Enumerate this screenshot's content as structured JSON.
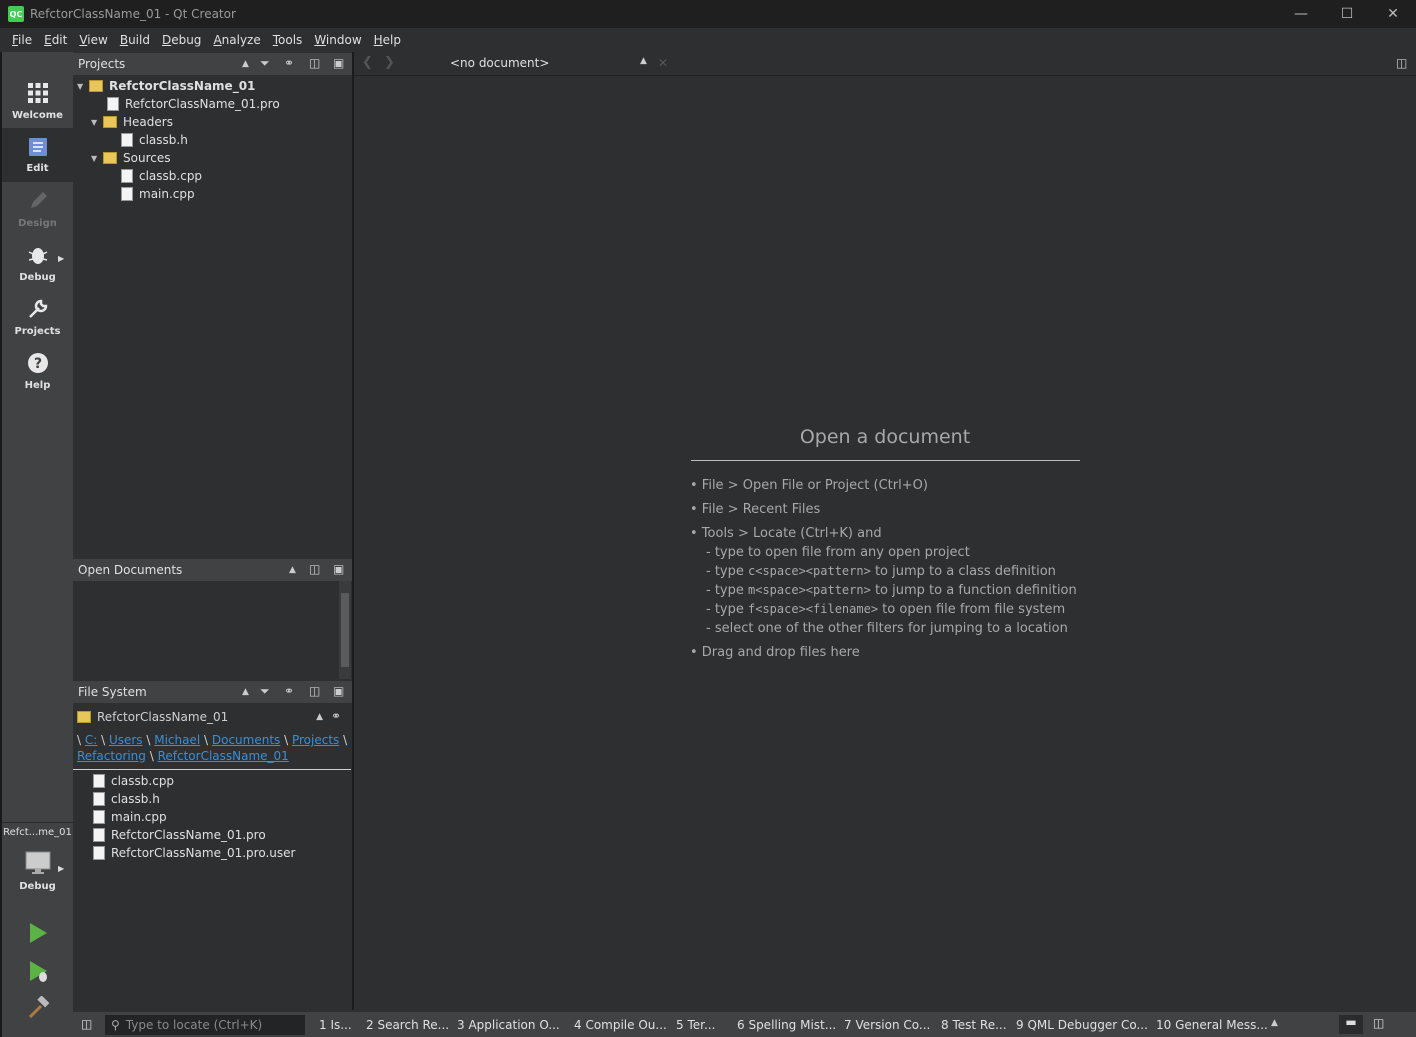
{
  "window": {
    "title": "RefctorClassName_01 - Qt Creator",
    "app_icon": "QC"
  },
  "menu": [
    {
      "mn": "F",
      "rest": "ile"
    },
    {
      "mn": "E",
      "rest": "dit"
    },
    {
      "mn": "V",
      "rest": "iew"
    },
    {
      "mn": "B",
      "rest": "uild"
    },
    {
      "mn": "D",
      "rest": "ebug"
    },
    {
      "mn": "A",
      "rest": "nalyze"
    },
    {
      "mn": "T",
      "rest": "ools"
    },
    {
      "mn": "W",
      "rest": "indow"
    },
    {
      "mn": "H",
      "rest": "elp"
    }
  ],
  "modes": {
    "welcome": "Welcome",
    "edit": "Edit",
    "design": "Design",
    "debug": "Debug",
    "projects": "Projects",
    "help": "Help"
  },
  "kit": {
    "project_short": "Refct...me_01",
    "build_config": "Debug"
  },
  "projects_pane": {
    "title": "Projects",
    "root": "RefctorClassName_01",
    "pro_file": "RefctorClassName_01.pro",
    "headers_label": "Headers",
    "header_files": [
      "classb.h"
    ],
    "sources_label": "Sources",
    "source_files": [
      "classb.cpp",
      "main.cpp"
    ]
  },
  "open_documents_pane": {
    "title": "Open Documents"
  },
  "file_system_pane": {
    "title": "File System",
    "root_combo": "RefctorClassName_01",
    "path_line1": [
      "C:",
      "Users",
      "Michael",
      "Documents",
      "Projects"
    ],
    "path_line2": [
      "Refactoring",
      "RefctorClassName_01"
    ],
    "files": [
      "classb.cpp",
      "classb.h",
      "main.cpp",
      "RefctorClassName_01.pro",
      "RefctorClassName_01.pro.user"
    ]
  },
  "editor": {
    "document_combo": "<no document>",
    "heading": "Open a document",
    "hint_open": "• File > Open File or Project (Ctrl+O)",
    "hint_recent": "• File > Recent Files",
    "hint_locate": "• Tools > Locate (Ctrl+K) and",
    "hint_type_open": "- type to open file from any open project",
    "hint_class_pre": "- type ",
    "hint_class_code": "c<space><pattern>",
    "hint_class_post": " to jump to a class definition",
    "hint_func_pre": "- type ",
    "hint_func_code": "m<space><pattern>",
    "hint_func_post": " to jump to a function definition",
    "hint_file_pre": "- type ",
    "hint_file_code": "f<space><filename>",
    "hint_file_post": " to open file from file system",
    "hint_filters": "- select one of the other filters for jumping to a location",
    "hint_drag": "• Drag and drop files here"
  },
  "statusbar": {
    "locator_placeholder": "Type to locate (Ctrl+K)",
    "output_panes": [
      "1  Is...",
      "2  Search Re...",
      "3  Application O...",
      "4  Compile Ou...",
      "5  Ter...",
      "6  Spelling Mist...",
      "7  Version Co...",
      "8  Test Re...",
      "9  QML Debugger Co...",
      "10  General Mess..."
    ]
  },
  "colors": {
    "accent": "#41cd52",
    "link": "#3a8fd8",
    "run_green": "#5bb346"
  }
}
